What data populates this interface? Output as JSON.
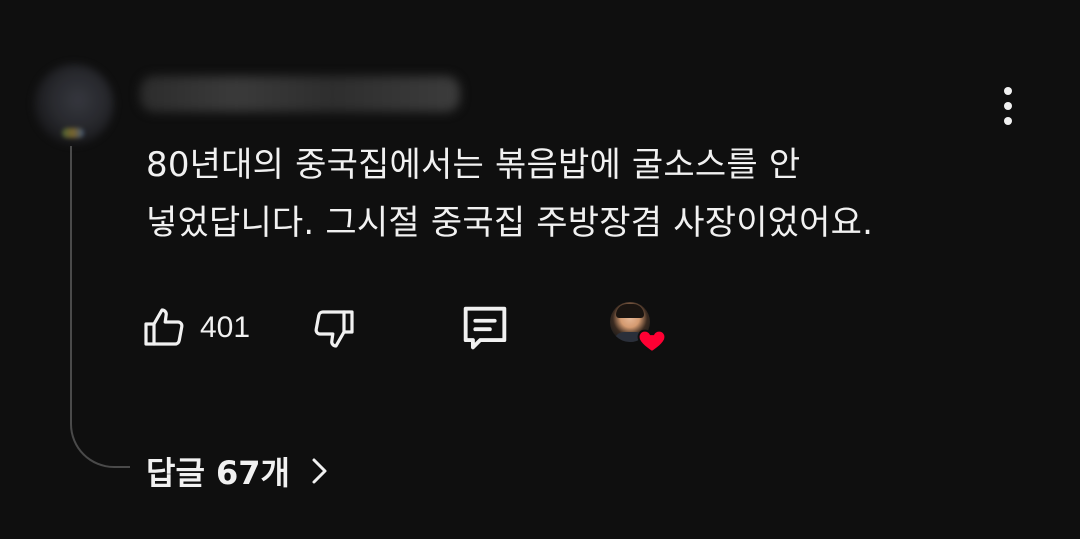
{
  "comment": {
    "author_name": "",
    "lines": [
      "80년대의 중국집에서는 볶음밥에 굴소스를 안",
      "넣었답니다.  그시절 중국집 주방장겸 사장이었어요."
    ],
    "like_count": "401",
    "replies_label": "답글 67개"
  },
  "icons": {
    "more": "more-vertical-icon",
    "like": "thumbs-up-icon",
    "dislike": "thumbs-down-icon",
    "reply": "comment-bubble-icon",
    "heart": "heart-icon",
    "chevron": "chevron-right-icon"
  },
  "colors": {
    "background": "#0f0f0f",
    "text": "#f1f1f1",
    "heart": "#ff0033",
    "thread_line": "#4a4a4a"
  }
}
